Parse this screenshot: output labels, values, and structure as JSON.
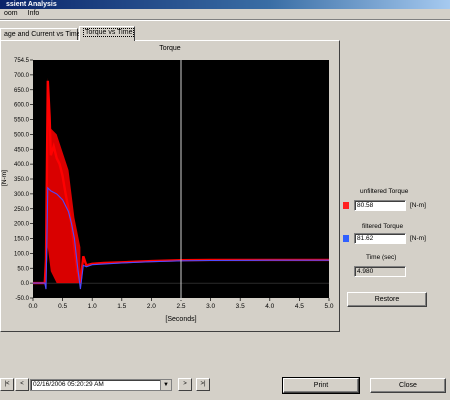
{
  "window": {
    "title": "ssient Analysis"
  },
  "menu": {
    "items": [
      "oom",
      "Info"
    ]
  },
  "tabs": [
    {
      "label": "age and Current vs Time",
      "active": false
    },
    {
      "label": "Torque vs Time",
      "active": true
    }
  ],
  "chart_data": {
    "type": "line",
    "title": "Torque",
    "xlabel": "[Seconds]",
    "ylabel": "[N-m]",
    "xlim": [
      0,
      5
    ],
    "ylim": [
      -50,
      750
    ],
    "grid": false,
    "background": "#000000",
    "x_ticks": [
      "0.0",
      "0.5",
      "1.0",
      "1.5",
      "2.0",
      "2.5",
      "3.0",
      "3.5",
      "4.0",
      "4.5",
      "5.0"
    ],
    "y_ticks": [
      "-50.0",
      "0.0",
      "50.0",
      "100.0",
      "150.0",
      "200.0",
      "250.0",
      "300.0",
      "350.0",
      "400.0",
      "450.0",
      "500.0",
      "550.0",
      "600.0",
      "650.0",
      "700.0",
      "754.5"
    ],
    "cursor_x": 2.5,
    "series": [
      {
        "color": "#ff0000",
        "points": [
          [
            0,
            0
          ],
          [
            0.1,
            0
          ],
          [
            0.2,
            0
          ],
          [
            0.22,
            80
          ],
          [
            0.25,
            680
          ],
          [
            0.28,
            560
          ],
          [
            0.3,
            430
          ],
          [
            0.35,
            460
          ],
          [
            0.4,
            420
          ],
          [
            0.45,
            400
          ],
          [
            0.5,
            360
          ],
          [
            0.55,
            300
          ],
          [
            0.6,
            250
          ],
          [
            0.65,
            200
          ],
          [
            0.7,
            120
          ],
          [
            0.75,
            40
          ],
          [
            0.8,
            0
          ],
          [
            0.85,
            90
          ],
          [
            0.9,
            60
          ],
          [
            1.0,
            65
          ],
          [
            1.2,
            68
          ],
          [
            1.5,
            70
          ],
          [
            2.0,
            74
          ],
          [
            2.5,
            77
          ],
          [
            3.0,
            78
          ],
          [
            3.5,
            78
          ],
          [
            4.0,
            78
          ],
          [
            4.5,
            78
          ],
          [
            5.0,
            78
          ]
        ],
        "band": [
          [
            [
              0.22,
              200
            ],
            [
              0.25,
              690
            ],
            [
              0.3,
              520
            ],
            [
              0.4,
              500
            ],
            [
              0.5,
              440
            ],
            [
              0.6,
              380
            ],
            [
              0.7,
              220
            ],
            [
              0.8,
              120
            ]
          ],
          [
            [
              0.22,
              0
            ],
            [
              0.25,
              120
            ],
            [
              0.3,
              40
            ],
            [
              0.4,
              0
            ],
            [
              0.5,
              0
            ],
            [
              0.6,
              0
            ],
            [
              0.7,
              0
            ],
            [
              0.8,
              0
            ]
          ]
        ]
      },
      {
        "color": "#4b4bff",
        "points": [
          [
            0,
            0
          ],
          [
            0.2,
            0
          ],
          [
            0.22,
            -20
          ],
          [
            0.25,
            320
          ],
          [
            0.3,
            310
          ],
          [
            0.4,
            300
          ],
          [
            0.5,
            280
          ],
          [
            0.6,
            240
          ],
          [
            0.65,
            200
          ],
          [
            0.7,
            150
          ],
          [
            0.75,
            60
          ],
          [
            0.8,
            -20
          ],
          [
            0.85,
            60
          ],
          [
            0.9,
            55
          ],
          [
            1.0,
            62
          ],
          [
            1.5,
            68
          ],
          [
            2.0,
            72
          ],
          [
            2.5,
            75
          ],
          [
            3.0,
            76
          ],
          [
            4.0,
            77
          ],
          [
            5.0,
            77
          ]
        ]
      }
    ]
  },
  "readouts": {
    "unfiltered": {
      "label": "unfiltered Torque",
      "value": "80.58",
      "unit": "[N-m]",
      "color": "#ff2020"
    },
    "filtered": {
      "label": "filtered Torque",
      "value": "81.62",
      "unit": "[N-m]",
      "color": "#3060ff"
    },
    "time": {
      "label": "Time (sec)",
      "value": "4.980"
    }
  },
  "buttons": {
    "restore": "Restore",
    "print": "Print",
    "close": "Close"
  },
  "navigation": {
    "datetime": "02/16/2006 05:20:29 AM",
    "first": "|<",
    "prev": "<",
    "next": ">",
    "last": ">|"
  }
}
